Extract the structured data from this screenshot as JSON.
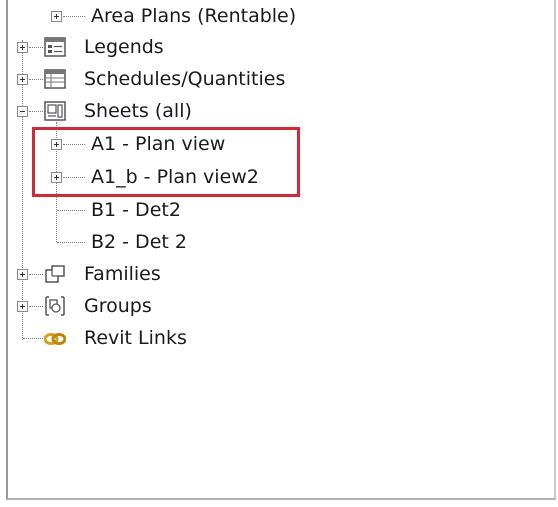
{
  "project_browser": {
    "items": [
      {
        "label": "Area Plans (Rentable)",
        "icon": "area-plan-icon",
        "expander": "plus"
      },
      {
        "label": "Legends",
        "icon": "legend-icon",
        "expander": "plus"
      },
      {
        "label": "Schedules/Quantities",
        "icon": "schedule-icon",
        "expander": "plus"
      },
      {
        "label": "Sheets (all)",
        "icon": "sheet-icon",
        "expander": "minus"
      },
      {
        "label": "A1 - Plan view",
        "expander": "plus"
      },
      {
        "label": "A1_b - Plan view2",
        "expander": "plus"
      },
      {
        "label": "B1 - Det2"
      },
      {
        "label": "B2 - Det 2"
      },
      {
        "label": "Families",
        "icon": "family-icon",
        "expander": "plus"
      },
      {
        "label": "Groups",
        "icon": "group-icon",
        "expander": "plus"
      },
      {
        "label": "Revit Links",
        "icon": "link-icon"
      }
    ]
  },
  "colors": {
    "highlight": "#d12a3a",
    "link_icon": "#d4a21a"
  }
}
